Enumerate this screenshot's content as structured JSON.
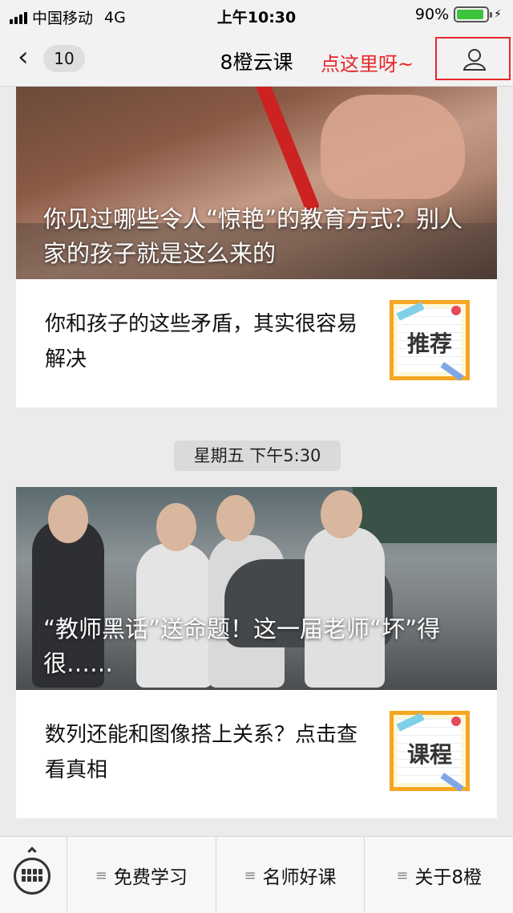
{
  "status": {
    "carrier": "中国移动",
    "network": "4G",
    "time": "上午10:30",
    "battery": "90%",
    "battery_level": 0.9
  },
  "nav": {
    "back_count": "10",
    "title": "8橙云课",
    "hint": "点这里呀~"
  },
  "feed": [
    {
      "hero_title": "你见过哪些令人“惊艳”的教育方式？别人家的孩子就是这么来的",
      "item_text": "你和孩子的这些矛盾，其实很容易解决",
      "thumb_label": "推荐"
    },
    {
      "timestamp": "星期五 下午5:30",
      "hero_title": "“教师黑话”送命题！这一届老师“坏”得很……",
      "item_text": "数列还能和图像搭上关系？点击查看真相",
      "thumb_label": "课程"
    }
  ],
  "menu": [
    {
      "label": "免费学习"
    },
    {
      "label": "名师好课"
    },
    {
      "label": "关于8橙"
    }
  ],
  "colors": {
    "accent_red": "#e8272a",
    "thumb_border": "#f5a623",
    "battery_green": "#3dc43d"
  }
}
